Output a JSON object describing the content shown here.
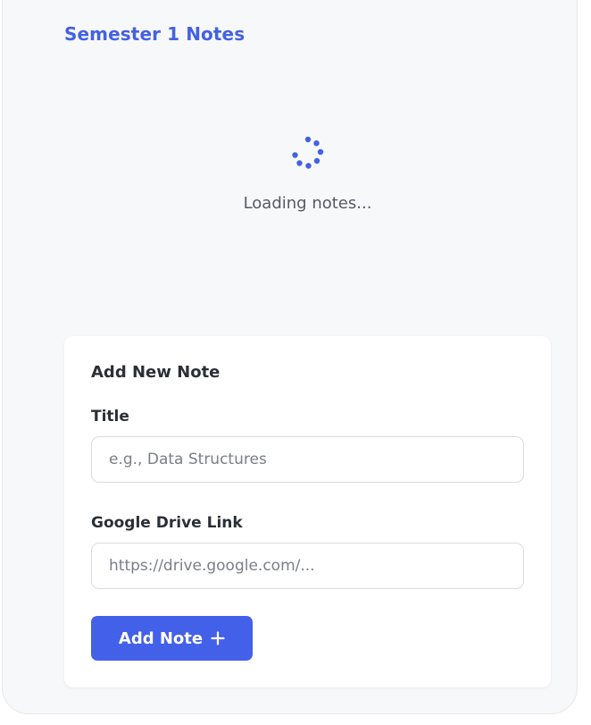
{
  "page": {
    "title": "Semester 1 Notes"
  },
  "loading": {
    "text": "Loading notes...",
    "spinner_icon": "loading-spinner-icon"
  },
  "add_note_form": {
    "heading": "Add New Note",
    "title_field": {
      "label": "Title",
      "value": "",
      "placeholder": "e.g., Data Structures"
    },
    "link_field": {
      "label": "Google Drive Link",
      "value": "",
      "placeholder": "https://drive.google.com/..."
    },
    "submit_button": {
      "label": "Add Note",
      "icon": "plus-icon"
    }
  },
  "colors": {
    "accent": "#4361e5",
    "button": "#4361e8",
    "panel_background": "#f7f8fa",
    "card_background": "#ffffff",
    "text_primary": "#2b2f36",
    "text_secondary": "#555a63"
  }
}
